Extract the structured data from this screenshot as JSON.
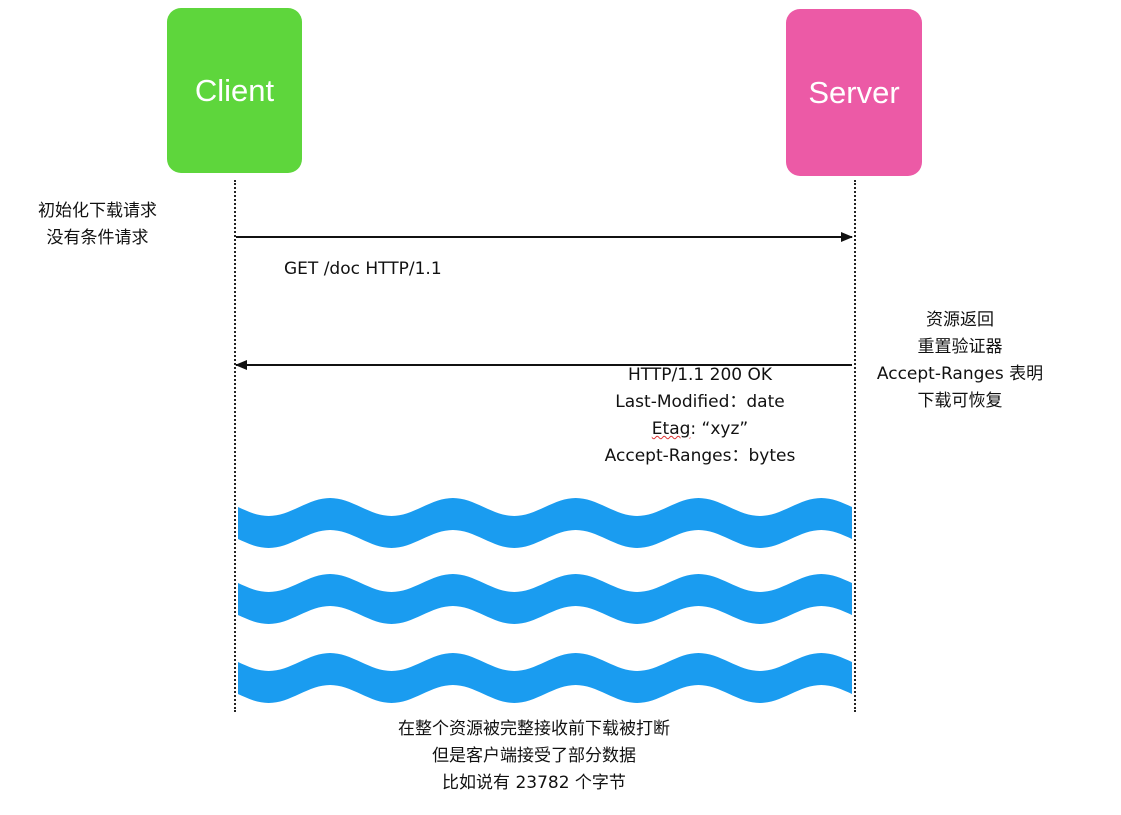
{
  "actors": {
    "client": "Client",
    "server": "Server"
  },
  "client_note": {
    "line1": "初始化下载请求",
    "line2": "没有条件请求"
  },
  "request": {
    "label": "GET /doc  HTTP/1.1"
  },
  "server_note": {
    "line1": "资源返回",
    "line2": "重置验证器",
    "line3": "Accept-Ranges 表明",
    "line4": "下载可恢复"
  },
  "response": {
    "status": "HTTP/1.1  200  OK",
    "last_modified": "Last-Modified：date",
    "etag_key": "Etag",
    "etag_value": ": “xyz”",
    "accept_ranges": "Accept-Ranges：bytes"
  },
  "bottom_note": {
    "line1": "在整个资源被完整接收前下载被打断",
    "line2": "但是客户端接受了部分数据",
    "line3": "比如说有 23782 个字节"
  },
  "colors": {
    "client": "#5ed63c",
    "server": "#ec5aa6",
    "wave": "#1a9cf0"
  }
}
